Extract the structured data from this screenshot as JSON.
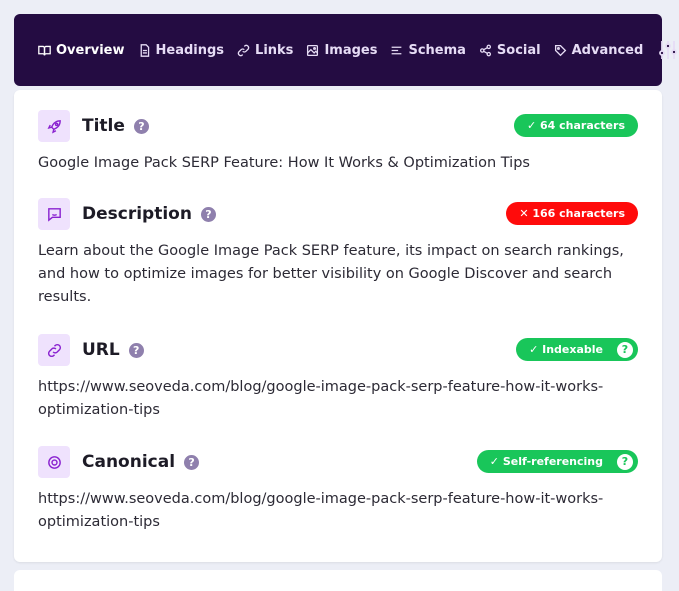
{
  "nav": {
    "tabs": [
      {
        "label": "Overview",
        "icon": "book-open-icon"
      },
      {
        "label": "Headings",
        "icon": "document-icon"
      },
      {
        "label": "Links",
        "icon": "link-icon"
      },
      {
        "label": "Images",
        "icon": "image-icon"
      },
      {
        "label": "Schema",
        "icon": "align-left-icon"
      },
      {
        "label": "Social",
        "icon": "share-icon"
      },
      {
        "label": "Advanced",
        "icon": "tags-icon"
      }
    ],
    "settings_icon": "sliders-icon"
  },
  "colors": {
    "nav_bg": "#240c42",
    "success": "#19c65a",
    "error": "#ff0b0b",
    "icon_accent": "#8a22d0"
  },
  "sections": {
    "title": {
      "label": "Title",
      "help": "?",
      "badge": "✓  64 characters",
      "status": "success",
      "value": "Google Image Pack SERP Feature: How It Works & Optimization Tips"
    },
    "description": {
      "label": "Description",
      "help": "?",
      "badge": "✕  166 characters",
      "status": "error",
      "value": "Learn about the Google Image Pack SERP feature, its impact on search rankings, and how to optimize images for better visibility on Google Discover and search results."
    },
    "url": {
      "label": "URL",
      "help": "?",
      "badge": "✓  Indexable",
      "status": "success",
      "value": "https://www.seoveda.com/blog/google-image-pack-serp-feature-how-it-works-optimization-tips"
    },
    "canonical": {
      "label": "Canonical",
      "help": "?",
      "badge": "✓  Self-referencing",
      "status": "success",
      "value": "https://www.seoveda.com/blog/google-image-pack-serp-feature-how-it-works-optimization-tips"
    }
  }
}
